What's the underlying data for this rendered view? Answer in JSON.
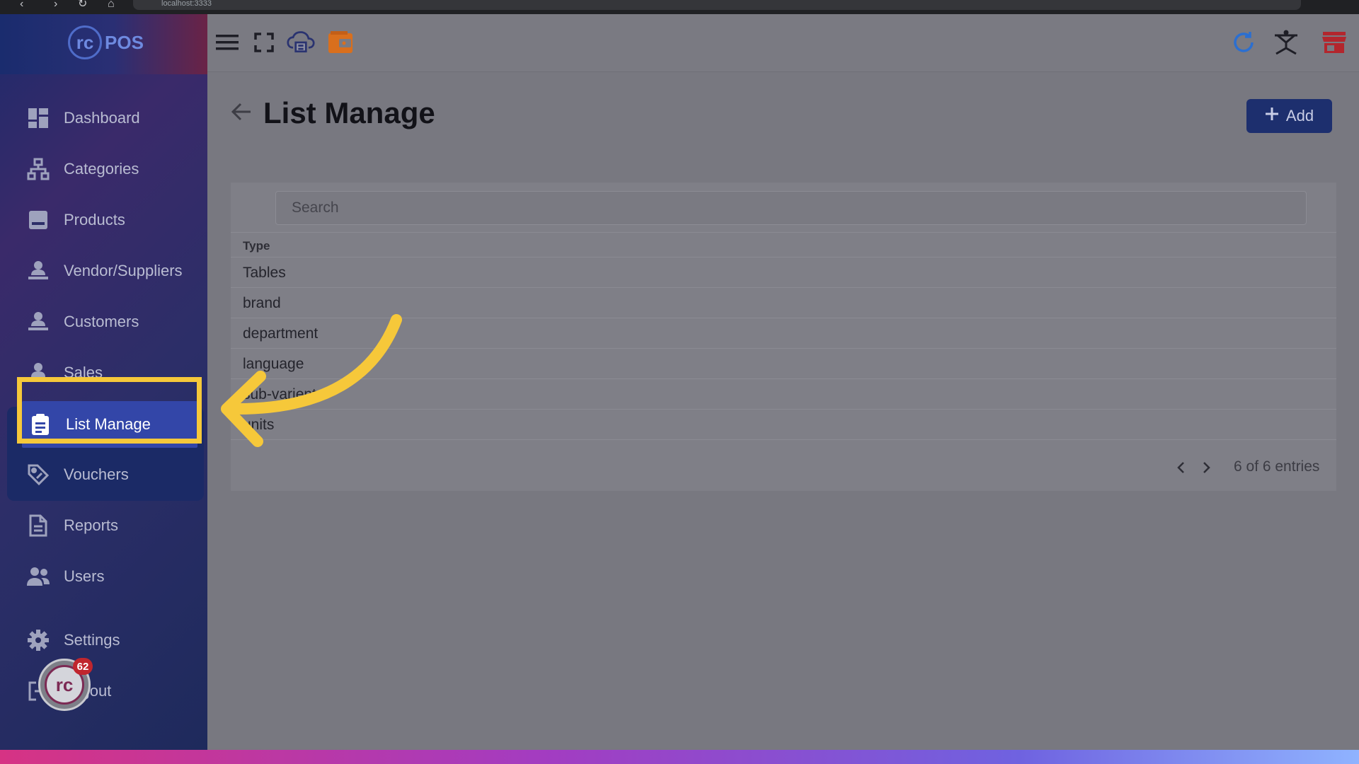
{
  "browser": {
    "url": "localhost:3333"
  },
  "app": {
    "logo_mark": "rc",
    "logo_text": "POS"
  },
  "sidebar": {
    "items": [
      {
        "label": "Dashboard",
        "icon": "dashboard-icon"
      },
      {
        "label": "Categories",
        "icon": "sitemap-icon"
      },
      {
        "label": "Products",
        "icon": "box-icon"
      },
      {
        "label": "Vendor/Suppliers",
        "icon": "person-desk-icon"
      },
      {
        "label": "Customers",
        "icon": "person-desk-icon"
      },
      {
        "label": "Sales",
        "icon": "person-desk-icon"
      },
      {
        "label": "List Manage",
        "icon": "clipboard-icon",
        "active": true
      },
      {
        "label": "Vouchers",
        "icon": "tag-icon"
      },
      {
        "label": "Reports",
        "icon": "document-icon"
      },
      {
        "label": "Users",
        "icon": "users-icon"
      },
      {
        "label": "Settings",
        "icon": "gear-icon"
      },
      {
        "label": "Logout",
        "icon": "logout-icon"
      }
    ]
  },
  "topbar": {
    "left_icons": [
      "menu-icon",
      "fullscreen-icon",
      "cloud-print-icon",
      "wallet-icon"
    ],
    "right_icons": [
      "refresh-icon",
      "network-icon",
      "store-icon"
    ]
  },
  "main": {
    "title": "List Manage",
    "add_label": "Add",
    "search_placeholder": "Search",
    "column_header": "Type",
    "rows": [
      "Tables",
      "brand",
      "department",
      "language",
      "sub-varient",
      "units"
    ],
    "entries_text": "6 of 6 entries"
  },
  "badge": {
    "count": "62"
  },
  "colors": {
    "accent": "#3346a8",
    "highlight": "#f6c83a",
    "add_button": "#1d2f6e",
    "wallet_icon": "#d96f1d",
    "store_icon": "#b3262d",
    "refresh_icon": "#2b6fd1"
  }
}
